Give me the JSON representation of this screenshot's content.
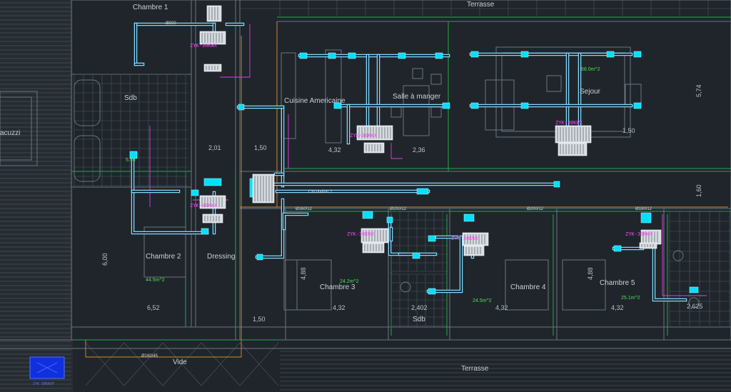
{
  "rooms": {
    "chambre1": "Chambre 1",
    "terrasse_top": "Terrasse",
    "cuisine": "Cuisine Americaine",
    "salle_manger": "Salle à manger",
    "sejour": "Sejour",
    "sdb_left": "Sdb",
    "jacuzzi": "acuzzi",
    "chambre2": "Chambre 2",
    "dressing": "Dressing",
    "chambre3": "Chambre 3",
    "chambre4": "Chambre 4",
    "chambre5": "Chambre 5",
    "sdb_mid": "Sdb",
    "vide": "Vide",
    "terrasse_bottom": "Terrasse",
    "circulation": "Circulation 2"
  },
  "areas": {
    "sejour": "68.0m^2",
    "chambre2": "44.5m^2",
    "chambre3": "24.2m^2",
    "chambre4": "24.5m^2",
    "chambre5": "25.1m^2",
    "sdb_left": "5.55"
  },
  "dimensions": {
    "d201": "2,01",
    "d150a": "1,50",
    "d432": "4,32",
    "d236": "2,36",
    "d574": "5,74",
    "d160": "1,60",
    "d600": "6,00",
    "d652": "6,52",
    "d150b": "1,50",
    "d432b": "4,32",
    "d432c": "4,32",
    "d432d": "4,32",
    "d488": "4,88",
    "d488b": "4,88",
    "d2402": "2,402",
    "d2625": "2,625"
  },
  "unit_tags": {
    "u1": "ZYK-30KWX",
    "u2": "ZYK-30KWX",
    "u3": "ZYK-30KWX",
    "u4": "ZYK-30KWX",
    "u5": "ZYK-30KWX",
    "u6": "ZYK-30KWX",
    "u7": "ZYK-30KWX",
    "legend": "ZYK-30KWXF"
  },
  "duct_sizes": {
    "s1": "Ø200",
    "s2": "Ø160/12",
    "s3": "Ø200/12",
    "s4": "Ø200/12",
    "s5": "Ø180/12",
    "s6": "Ø160/45"
  },
  "colors": {
    "background": "#1f252b",
    "duct": "#7fd8ff",
    "grille": "#00e0ff",
    "wall": "#6b757f",
    "green_wall": "#2aa84a",
    "tag": "#ff44ff",
    "area": "#4fe04f",
    "legend_fill": "#1030e0"
  }
}
